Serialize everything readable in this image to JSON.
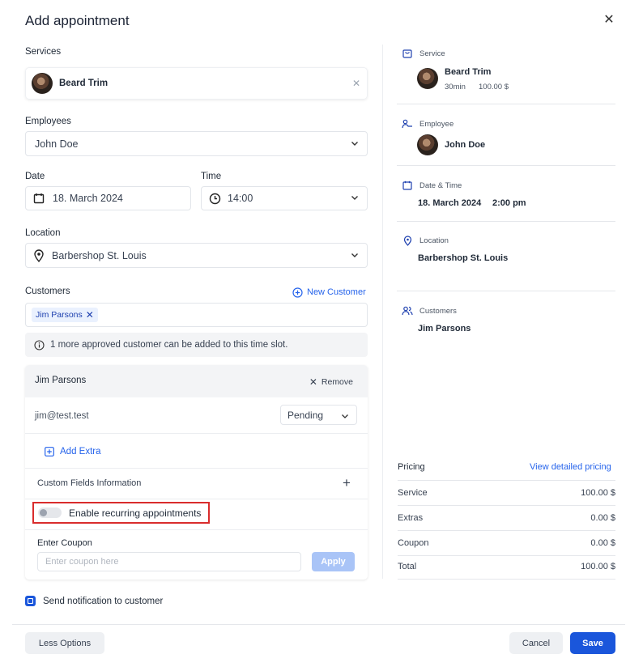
{
  "dialog": {
    "title": "Add appointment"
  },
  "services": {
    "label": "Services",
    "selected": "Beard Trim"
  },
  "employees": {
    "label": "Employees",
    "selected": "John Doe"
  },
  "date": {
    "label": "Date",
    "value": "18. March 2024"
  },
  "time": {
    "label": "Time",
    "value": "14:00"
  },
  "location": {
    "label": "Location",
    "value": "Barbershop St. Louis"
  },
  "customers": {
    "label": "Customers",
    "new_customer": "New Customer",
    "tag": "Jim Parsons",
    "info": "1 more approved customer can be added to this time slot."
  },
  "customer_panel": {
    "name": "Jim Parsons",
    "remove": "Remove",
    "email": "jim@test.test",
    "status": "Pending",
    "add_extra": "Add Extra",
    "custom_fields": "Custom Fields Information",
    "recurring": "Enable recurring appointments",
    "recurring_enabled": false,
    "coupon_label": "Enter Coupon",
    "coupon_placeholder": "Enter coupon here",
    "apply": "Apply"
  },
  "notification": {
    "label": "Send notification to customer",
    "checked": true
  },
  "summary": {
    "service_head": "Service",
    "service_name": "Beard Trim",
    "service_duration": "30min",
    "service_price": "100.00 $",
    "employee_head": "Employee",
    "employee_name": "John Doe",
    "datetime_head": "Date & Time",
    "date": "18. March 2024",
    "time": "2:00 pm",
    "location_head": "Location",
    "location": "Barbershop St. Louis",
    "customers_head": "Customers",
    "customer": "Jim Parsons"
  },
  "pricing": {
    "title": "Pricing",
    "link": "View detailed pricing",
    "rows": [
      {
        "label": "Service",
        "value": "100.00 $"
      },
      {
        "label": "Extras",
        "value": "0.00 $"
      },
      {
        "label": "Coupon",
        "value": "0.00 $"
      },
      {
        "label": "Total",
        "value": "100.00 $"
      }
    ]
  },
  "footer": {
    "less_options": "Less Options",
    "cancel": "Cancel",
    "save": "Save"
  },
  "colors": {
    "primary": "#1a56db",
    "highlight": "#d92c2c",
    "apply_disabled": "#a9c4f7"
  }
}
